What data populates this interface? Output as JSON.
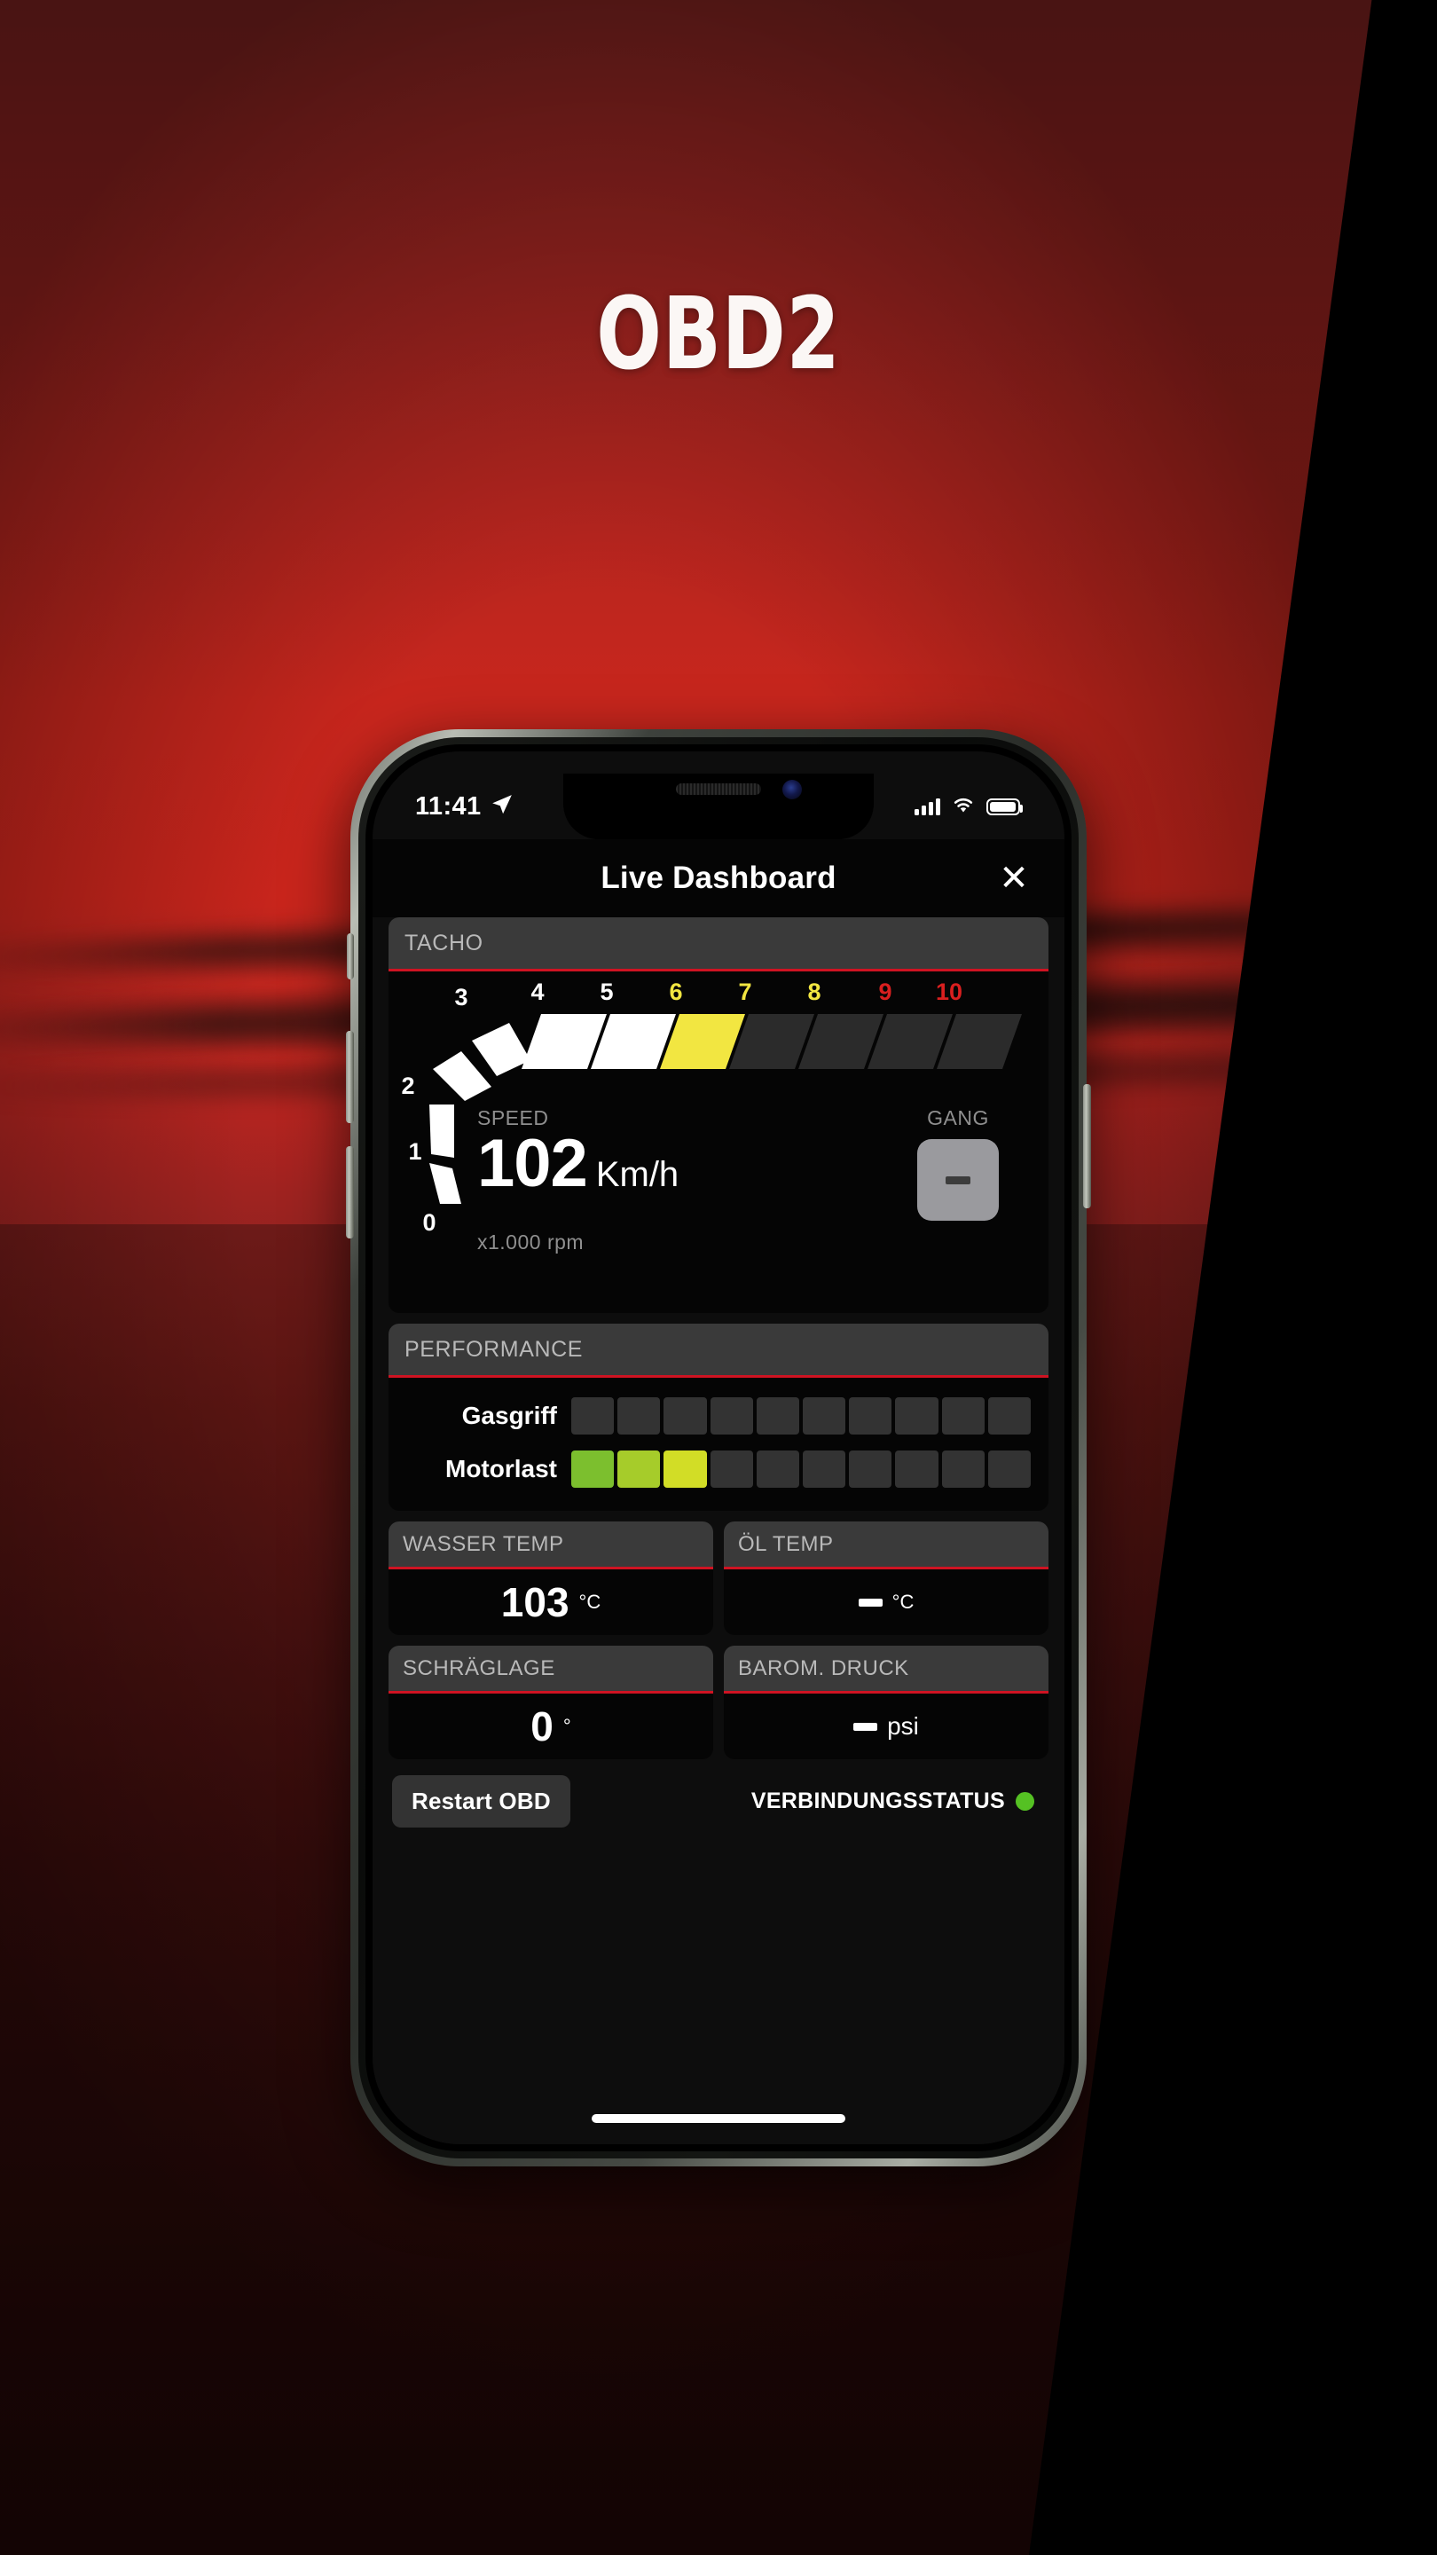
{
  "hero": {
    "title": "OBD2"
  },
  "status_bar": {
    "time": "11:41",
    "location_icon": "location-arrow-icon",
    "signal_icon": "cellular-bars-icon",
    "wifi_icon": "wifi-icon",
    "battery_icon": "battery-icon"
  },
  "app_header": {
    "title": "Live Dashboard",
    "close_icon": "✕"
  },
  "tacho": {
    "section_title": "TACHO",
    "scale_labels": [
      "0",
      "1",
      "2",
      "3",
      "4",
      "5",
      "6",
      "7",
      "8",
      "9",
      "10"
    ],
    "rpm_unit": "x1.000 rpm",
    "speed_label": "SPEED",
    "speed_value": "102",
    "speed_unit": "Km/h",
    "gear_label": "GANG",
    "gear_value": "-",
    "segments_total": 10,
    "segments_filled": 6,
    "colors": {
      "fill_white": "#ffffff",
      "fill_yellow": "#f2e641",
      "empty": "#2b2b2b",
      "label_white": "#ffffff",
      "label_yellow": "#f2e641",
      "label_red": "#d91f1f"
    }
  },
  "performance": {
    "section_title": "PERFORMANCE",
    "rows": [
      {
        "label": "Gasgriff",
        "filled": 0,
        "total": 10
      },
      {
        "label": "Motorlast",
        "filled": 3,
        "total": 10
      }
    ],
    "fill_colors": [
      "#7cbf2e",
      "#a6cc2a",
      "#d2dd26"
    ]
  },
  "metrics": [
    {
      "title": "WASSER TEMP",
      "value": "103",
      "unit": "°C",
      "is_dash": false
    },
    {
      "title": "ÖL TEMP",
      "value": "-",
      "unit": "°C",
      "is_dash": true
    },
    {
      "title": "SCHRÄGLAGE",
      "value": "0",
      "unit": "°",
      "is_dash": false
    },
    {
      "title": "BAROM. DRUCK",
      "value": "-",
      "unit": "psi",
      "is_dash": true
    }
  ],
  "footer": {
    "restart_label": "Restart OBD",
    "connection_label": "VERBINDUNGSSTATUS",
    "connection_color": "#55c123"
  },
  "theme": {
    "accent_red": "#cf1322",
    "bg_red": "#c8261d",
    "card_header": "#3a3a3a",
    "card_body": "#050505"
  }
}
